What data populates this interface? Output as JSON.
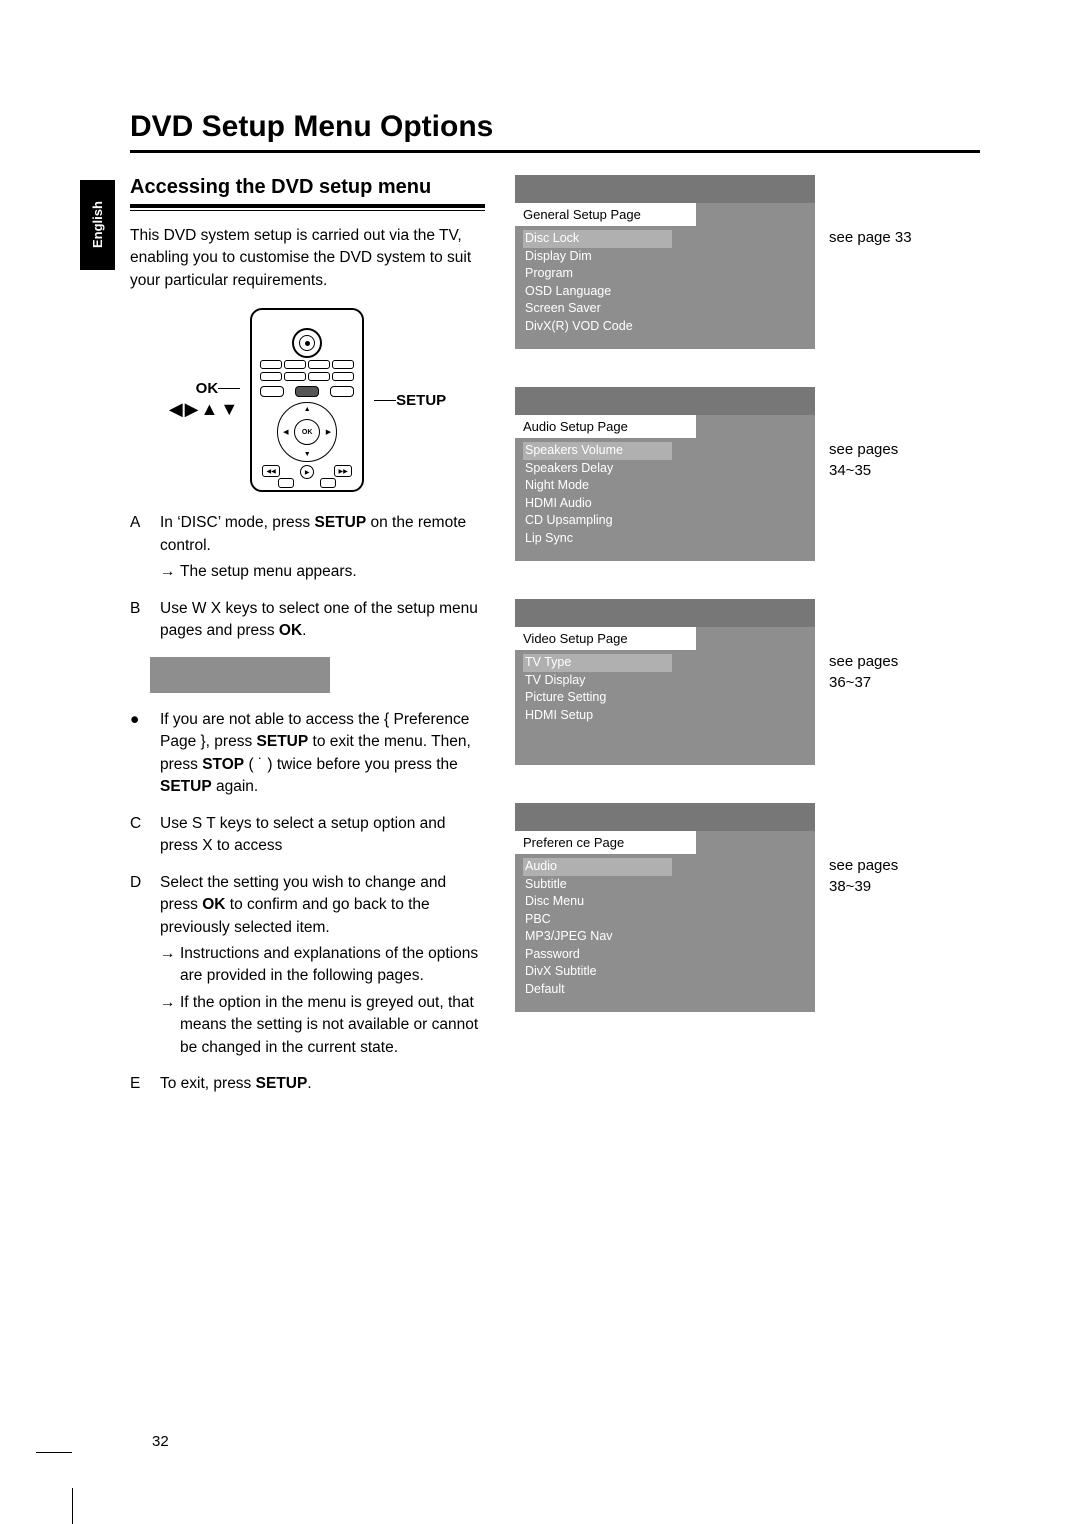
{
  "lang_tab": "English",
  "title": "DVD Setup Menu Options",
  "section_heading": "Accessing the DVD setup menu",
  "intro": "This DVD system setup is carried out via the TV, enabling you to customise the DVD system to suit your particular requirements.",
  "remote": {
    "left_label": "OK",
    "right_label": "SETUP",
    "arrows": "◀▶▲▼",
    "ok_center": "OK"
  },
  "steps": {
    "A": {
      "letter": "A",
      "text_pre": "In ‘DISC’ mode, press ",
      "bold1": "SETUP",
      "text_post": " on the remote control.",
      "sub1": "The setup menu appears."
    },
    "B": {
      "letter": "B",
      "text_pre": "Use  W X keys to select one of the setup menu pages and press ",
      "bold1": "OK",
      "text_post": "."
    },
    "bullet": {
      "text_1": "If you are not able to access the { Preference Page }, press ",
      "bold1": "SETUP",
      "text_2": " to exit the menu.  Then, press ",
      "bold2": "STOP",
      "text_3": " ( ˙   ) twice before you press the ",
      "bold3": "SETUP",
      "text_4": " again."
    },
    "C": {
      "letter": "C",
      "text": "Use  S  T keys to select a setup option and press  X to access"
    },
    "D": {
      "letter": "D",
      "text_pre": "Select the setting you wish to change and press ",
      "bold1": "OK",
      "text_post": " to confirm and go back to the previously selected item.",
      "sub1": "Instructions and explanations of the options are provided in the following pages.",
      "sub2": "If the option in the menu is greyed out, that means the setting is not available or cannot be changed in the current state."
    },
    "E": {
      "letter": "E",
      "text_pre": "To exit, press ",
      "bold1": "SETUP",
      "text_post": "."
    }
  },
  "menus": [
    {
      "header": "General Setup Page",
      "items": [
        "Disc Lock",
        "Display Dim",
        "Program",
        "OSD Language",
        "Screen Saver",
        "DivX(R) VOD Code"
      ],
      "highlight_first": true,
      "ref": "see page 33"
    },
    {
      "header": "Audio Setup Page",
      "items": [
        "Speakers Volume",
        "Speakers Delay",
        "Night Mode",
        "HDMI Audio",
        "CD Upsampling",
        "Lip Sync"
      ],
      "highlight_first": true,
      "ref": "see pages\n34~35"
    },
    {
      "header": "Video Setup Page",
      "items": [
        "TV Type",
        "TV Display",
        "Picture Setting",
        "HDMI Setup"
      ],
      "highlight_first": true,
      "ref": "see pages\n36~37"
    },
    {
      "header": "Preferen ce Page",
      "items": [
        "Audio",
        "Subtitle",
        "Disc Menu",
        "PBC",
        "MP3/JPEG Nav",
        "Password",
        "DivX Subtitle",
        "Default"
      ],
      "highlight_first": true,
      "ref": "see pages\n38~39"
    }
  ],
  "page_number": "32"
}
